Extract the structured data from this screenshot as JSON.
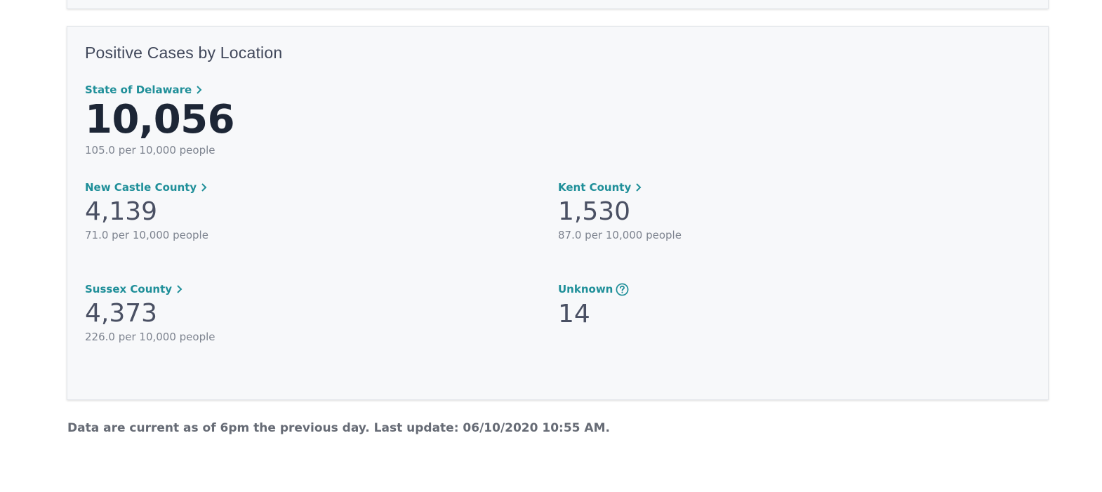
{
  "card": {
    "title": "Positive Cases by Location"
  },
  "state": {
    "label": "State of Delaware",
    "value": "10,056",
    "rate": "105.0 per 10,000 people"
  },
  "counties": [
    {
      "label": "New Castle County",
      "value": "4,139",
      "rate": "71.0 per 10,000 people"
    },
    {
      "label": "Kent County",
      "value": "1,530",
      "rate": "87.0 per 10,000 people"
    },
    {
      "label": "Sussex County",
      "value": "4,373",
      "rate": "226.0 per 10,000 people"
    },
    {
      "label": "Unknown",
      "value": "14"
    }
  ],
  "footer": {
    "note": "Data are current as of 6pm the previous day. Last update: 06/10/2020 10:55 AM."
  },
  "colors": {
    "link": "#1f8f99",
    "primary_number": "#1d2636",
    "card_background": "#f7f8fa"
  },
  "icons": {
    "link_chevron": "chevron-right-icon",
    "help": "question-circle-icon"
  }
}
